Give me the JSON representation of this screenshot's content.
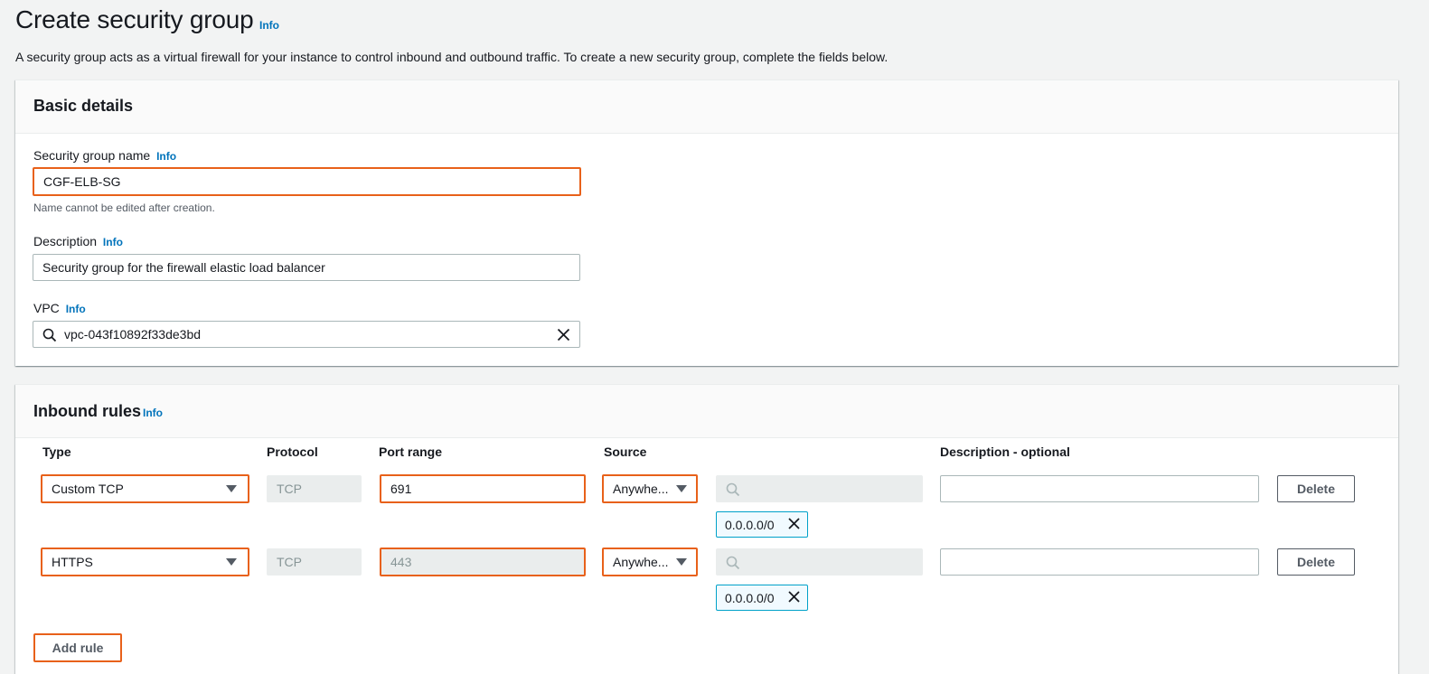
{
  "page": {
    "title": "Create security group",
    "title_info": "Info",
    "description": "A security group acts as a virtual firewall for your instance to control inbound and outbound traffic. To create a new security group, complete the fields below."
  },
  "basic_details": {
    "header": "Basic details",
    "name_label": "Security group name",
    "name_info": "Info",
    "name_value": "CGF-ELB-SG",
    "name_hint": "Name cannot be edited after creation.",
    "desc_label": "Description",
    "desc_info": "Info",
    "desc_value": "Security group for the firewall elastic load balancer",
    "vpc_label": "VPC",
    "vpc_info": "Info",
    "vpc_value": "vpc-043f10892f33de3bd"
  },
  "inbound": {
    "header": "Inbound rules",
    "info": "Info",
    "columns": {
      "type": "Type",
      "protocol": "Protocol",
      "port_range": "Port range",
      "source": "Source",
      "description": "Description - optional"
    },
    "rules": [
      {
        "type": "Custom TCP",
        "protocol": "TCP",
        "port_range": "691",
        "source": "Anywhe...",
        "cidr": "0.0.0.0/0",
        "description": "",
        "delete_label": "Delete"
      },
      {
        "type": "HTTPS",
        "protocol": "TCP",
        "port_range": "443",
        "source": "Anywhe...",
        "cidr": "0.0.0.0/0",
        "description": "",
        "delete_label": "Delete"
      }
    ],
    "add_rule_label": "Add rule"
  },
  "colors": {
    "accent_highlight": "#e8611a",
    "link": "#0073bb",
    "token_border": "#00a1c9",
    "token_bg": "#f1faff"
  },
  "icons": [
    "search-icon",
    "close-icon",
    "caret-down-icon"
  ]
}
